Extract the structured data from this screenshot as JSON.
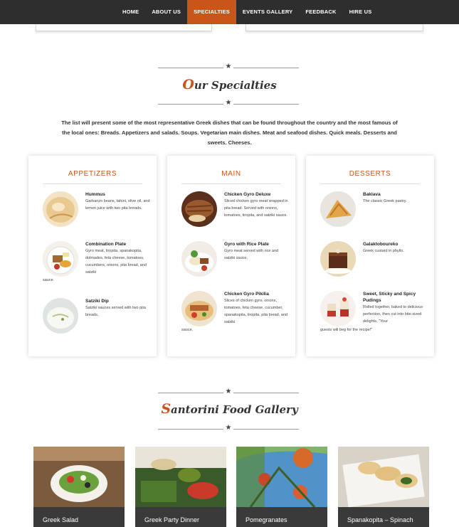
{
  "nav": {
    "items": [
      {
        "label": "HOME",
        "active": false
      },
      {
        "label": "ABOUT US",
        "active": false
      },
      {
        "label": "SPECIALTIES",
        "active": true
      },
      {
        "label": "EVENTS GALLERY",
        "active": false
      },
      {
        "label": "FEEDBACK",
        "active": false
      },
      {
        "label": "HIRE US",
        "active": false
      }
    ]
  },
  "specialties": {
    "title_first": "O",
    "title_rest": "ur Specialties",
    "intro": "The list will present some of the most representative Greek dishes that can be found throughout the country and the most famous of the local ones: Breads. Appetizers and salads. Soups. Vegetarian main dishes. Meat and seafood dishes. Quick meals. Desserts and sweets. Cheeses."
  },
  "cards": [
    {
      "title": "APPETIZERS",
      "dishes": [
        {
          "name": "Hummus",
          "desc": "Garbanzo beans, tahini, olive oil, and lemon juice with two pita breads.",
          "tail": ""
        },
        {
          "name": "Combination Plate",
          "desc": "Gyro meat, tiropita, spanakopita, dolmades, feta cheese, tomatoes, cucumbers, onions, pita bread, and satziki",
          "tail": "sauce."
        },
        {
          "name": "Satziki Dip",
          "desc": "Satziki sauces served with two pita breads.",
          "tail": ""
        }
      ]
    },
    {
      "title": "MAIN",
      "dishes": [
        {
          "name": "Chicken Gyro Deluxe",
          "desc": "Sliced chicken gyro meat wrapped in pita bread. Served with onions, tomatoes, tiropita, and satziki sauce.",
          "tail": ""
        },
        {
          "name": "Gyro with Rice Plate",
          "desc": "Gyro meat served with rice and satziki sauce.",
          "tail": ""
        },
        {
          "name": "Chicken Gyro Pikilia",
          "desc": "Slices of chicken gyro, onions, tomatoes, feta cheese, cucumber, spanakopita, tiropita, pita bread, and satziki",
          "tail": "sauce."
        }
      ]
    },
    {
      "title": "DESSERTS",
      "dishes": [
        {
          "name": "Baklava",
          "desc": "The classic Greek pastry.",
          "tail": ""
        },
        {
          "name": "Galaktoboureko",
          "desc": "Greek custard in phyllo.",
          "tail": ""
        },
        {
          "name": "Sweet, Sticky and Spicy Pudings",
          "desc": "Rolled together, baked to delicious perfection, then cut into bite-sized delights. \"Your",
          "tail": "guests will beg for the recipe!\""
        }
      ]
    }
  ],
  "gallery": {
    "title_first": "S",
    "title_rest": "antorini Food Gallery",
    "items": [
      {
        "caption": "Greek Salad"
      },
      {
        "caption": "Greek Party Dinner"
      },
      {
        "caption": "Pomegranates"
      },
      {
        "caption": "Spanakopita – Spinach"
      }
    ]
  },
  "colors": {
    "accent": "#c8561a",
    "nav_bg": "#2e2e2e",
    "caption_bg": "#3a3a3a"
  }
}
